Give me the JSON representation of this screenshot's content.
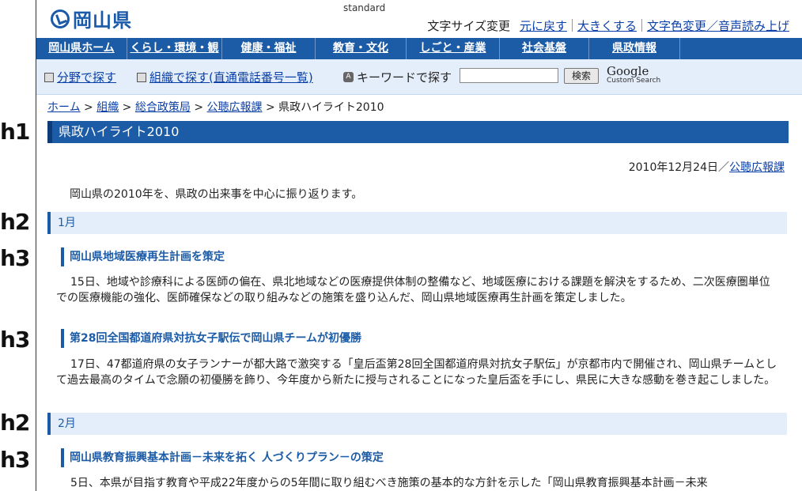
{
  "labels": {
    "h1": "h1",
    "h2a": "h2",
    "h3a": "h3",
    "h3b": "h3",
    "h2b": "h2",
    "h3c": "h3"
  },
  "header": {
    "logo_text": "岡山県",
    "standard": "standard",
    "text_size_label": "文字サイズ変更",
    "reset_label": "元に戻す",
    "bigger_label": "大きくする",
    "color_voice_label": "文字色変更／音声読み上げ"
  },
  "global_nav": [
    "岡山県ホーム",
    "くらし・環境・観光",
    "健康・福祉",
    "教育・文化",
    "しごと・産業",
    "社会基盤",
    "県政情報"
  ],
  "sub_nav": {
    "field_search": "分野で探す",
    "org_search": "組織で探す(直通電話番号一覧)",
    "keyword_label": "キーワードで探す",
    "search_placeholder": "",
    "search_button": "検索",
    "google_brand": "Google",
    "google_sub": "Custom Search"
  },
  "breadcrumb": {
    "home": "ホーム",
    "sep": " > ",
    "item1": "組織",
    "item2": "総合政策局",
    "item3": "公聴広報課",
    "current": "県政ハイライト2010"
  },
  "page": {
    "title": "県政ハイライト2010",
    "date": "2010年12月24日／",
    "dept": "公聴広報課",
    "intro": "岡山県の2010年を、県政の出来事を中心に振り返ります。"
  },
  "sections": {
    "month1": "1月",
    "item1_title": "岡山県地域医療再生計画を策定",
    "item1_body": "15日、地域や診療科による医師の偏在、県北地域などの医療提供体制の整備など、地域医療における課題を解決をするため、二次医療圏単位での医療機能の強化、医師確保などの取り組みなどの施策を盛り込んだ、岡山県地域医療再生計画を策定しました。",
    "item2_title": "第28回全国都道府県対抗女子駅伝で岡山県チームが初優勝",
    "item2_body": "17日、47都道府県の女子ランナーが都大路で激突する「皇后盃第28回全国都道府県対抗女子駅伝」が京都市内で開催され、岡山県チームとして過去最高のタイムで念願の初優勝を飾り、今年度から新たに授与されることになった皇后盃を手にし、県民に大きな感動を巻き起こしました。",
    "month2": "2月",
    "item3_title": "岡山県教育振興基本計画－未来を拓く 人づくりプラン－の策定",
    "item3_body": "5日、本県が目指す教育や平成22年度からの5年間に取り組むべき施策の基本的な方針を示した「岡山県教育振興基本計画－未来"
  }
}
